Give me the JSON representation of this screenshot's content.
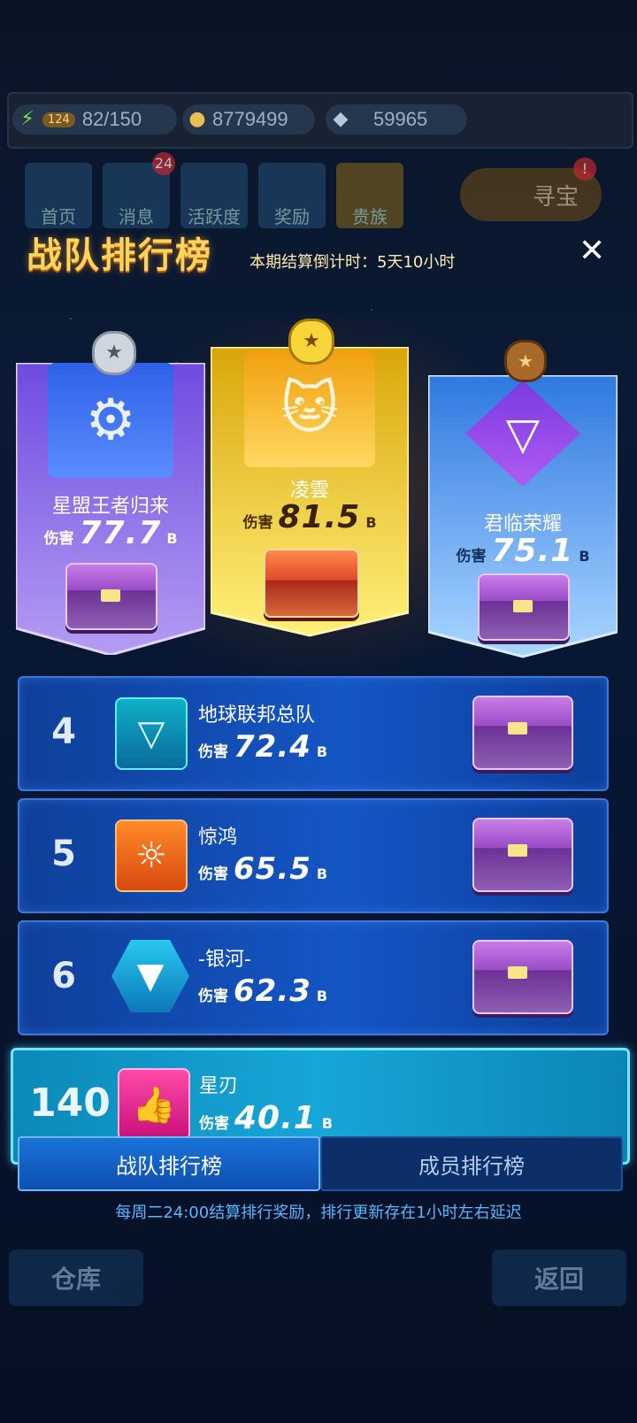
{
  "resources": {
    "energy_level": "124",
    "energy_value": "82/150",
    "gold": "8779499",
    "diamond": "59965"
  },
  "nav": [
    {
      "label": "首页",
      "icon": "home-icon"
    },
    {
      "label": "消息",
      "icon": "mail-icon",
      "badge": "24"
    },
    {
      "label": "活跃度",
      "icon": "smile-icon"
    },
    {
      "label": "奖励",
      "icon": "gift-icon"
    },
    {
      "label": "贵族",
      "icon": "crown-icon"
    }
  ],
  "treasure": {
    "label": "寻宝",
    "badge": "!"
  },
  "panel": {
    "title": "战队排行榜",
    "countdown_label": "本期结算倒计时：",
    "countdown_value": "5天10小时",
    "close": "✕"
  },
  "damage_label": "伤害",
  "unit": "B",
  "podium": [
    {
      "rank": 2,
      "name": "星盟王者归来",
      "damage": "77.7",
      "color": "#7a52e0"
    },
    {
      "rank": 1,
      "name": "凌雲",
      "damage": "81.5",
      "color": "#e8b410"
    },
    {
      "rank": 3,
      "name": "君临荣耀",
      "damage": "75.1",
      "color": "#4a8ee8"
    }
  ],
  "rows": [
    {
      "rank": "4",
      "name": "地球联邦总队",
      "damage": "72.4"
    },
    {
      "rank": "5",
      "name": "惊鸿",
      "damage": "65.5"
    },
    {
      "rank": "6",
      "name": "-银河-",
      "damage": "62.3"
    }
  ],
  "my_row": {
    "rank": "140",
    "name": "星刃",
    "damage": "40.1"
  },
  "tabs": {
    "team": "战队排行榜",
    "member": "成员排行榜"
  },
  "note": "每周二24:00结算排行奖励，排行更新存在1小时左右延迟",
  "bottom": {
    "left": "仓库",
    "right": "返回"
  }
}
